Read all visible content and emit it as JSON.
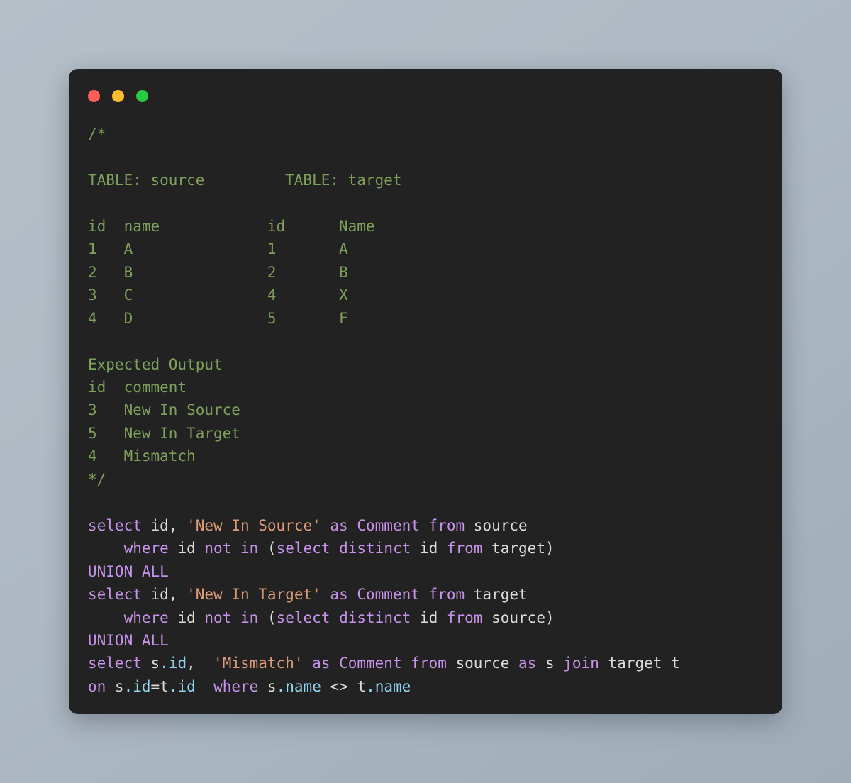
{
  "window": {
    "traffic_lights": [
      {
        "name": "close",
        "color": "#ff5f56"
      },
      {
        "name": "minimize",
        "color": "#ffbd2e"
      },
      {
        "name": "maximize",
        "color": "#27c93f"
      }
    ],
    "background_color": "#222222",
    "page_background_color": "#aeb9c3"
  },
  "theme": {
    "comment_color": "#7fa05a",
    "keyword_color": "#c792ea",
    "string_color": "#dd9a77",
    "identifier_color": "#dcdcdc",
    "property_color": "#8fd4f0"
  },
  "editor": {
    "language": "sql",
    "lines": [
      {
        "id": "l1",
        "tokens": [
          {
            "t": "/*",
            "c": "comment"
          }
        ]
      },
      {
        "id": "l2",
        "tokens": []
      },
      {
        "id": "l3",
        "tokens": [
          {
            "t": "TABLE: source         TABLE: target",
            "c": "comment"
          }
        ]
      },
      {
        "id": "l4",
        "tokens": []
      },
      {
        "id": "l5",
        "tokens": [
          {
            "t": "id  name            id      Name",
            "c": "comment"
          }
        ]
      },
      {
        "id": "l6",
        "tokens": [
          {
            "t": "1   A               1       A",
            "c": "comment"
          }
        ]
      },
      {
        "id": "l7",
        "tokens": [
          {
            "t": "2   B               2       B",
            "c": "comment"
          }
        ]
      },
      {
        "id": "l8",
        "tokens": [
          {
            "t": "3   C               4       X",
            "c": "comment"
          }
        ]
      },
      {
        "id": "l9",
        "tokens": [
          {
            "t": "4   D               5       F",
            "c": "comment"
          }
        ]
      },
      {
        "id": "l10",
        "tokens": []
      },
      {
        "id": "l11",
        "tokens": [
          {
            "t": "Expected Output",
            "c": "comment"
          }
        ]
      },
      {
        "id": "l12",
        "tokens": [
          {
            "t": "id  comment",
            "c": "comment"
          }
        ]
      },
      {
        "id": "l13",
        "tokens": [
          {
            "t": "3   New In Source",
            "c": "comment"
          }
        ]
      },
      {
        "id": "l14",
        "tokens": [
          {
            "t": "5   New In Target",
            "c": "comment"
          }
        ]
      },
      {
        "id": "l15",
        "tokens": [
          {
            "t": "4   Mismatch",
            "c": "comment"
          }
        ]
      },
      {
        "id": "l16",
        "tokens": [
          {
            "t": "*/",
            "c": "comment"
          }
        ]
      },
      {
        "id": "l17",
        "tokens": []
      },
      {
        "id": "l18",
        "tokens": [
          {
            "t": "select",
            "c": "keyword"
          },
          {
            "t": " ",
            "c": "punct"
          },
          {
            "t": "id",
            "c": "ident"
          },
          {
            "t": ", ",
            "c": "punct"
          },
          {
            "t": "'New In Source'",
            "c": "string"
          },
          {
            "t": " ",
            "c": "punct"
          },
          {
            "t": "as",
            "c": "keyword"
          },
          {
            "t": " ",
            "c": "punct"
          },
          {
            "t": "Comment",
            "c": "keyword"
          },
          {
            "t": " ",
            "c": "punct"
          },
          {
            "t": "from",
            "c": "keyword"
          },
          {
            "t": " ",
            "c": "punct"
          },
          {
            "t": "source",
            "c": "ident"
          }
        ]
      },
      {
        "id": "l19",
        "tokens": [
          {
            "t": "    ",
            "c": "punct"
          },
          {
            "t": "where",
            "c": "keyword"
          },
          {
            "t": " ",
            "c": "punct"
          },
          {
            "t": "id",
            "c": "ident"
          },
          {
            "t": " ",
            "c": "punct"
          },
          {
            "t": "not",
            "c": "keyword"
          },
          {
            "t": " ",
            "c": "punct"
          },
          {
            "t": "in",
            "c": "keyword"
          },
          {
            "t": " (",
            "c": "punct"
          },
          {
            "t": "select",
            "c": "keyword"
          },
          {
            "t": " ",
            "c": "punct"
          },
          {
            "t": "distinct",
            "c": "keyword"
          },
          {
            "t": " ",
            "c": "punct"
          },
          {
            "t": "id",
            "c": "ident"
          },
          {
            "t": " ",
            "c": "punct"
          },
          {
            "t": "from",
            "c": "keyword"
          },
          {
            "t": " ",
            "c": "punct"
          },
          {
            "t": "target",
            "c": "ident"
          },
          {
            "t": ")",
            "c": "punct"
          }
        ]
      },
      {
        "id": "l20",
        "tokens": [
          {
            "t": "UNION ALL",
            "c": "keyword"
          }
        ]
      },
      {
        "id": "l21",
        "tokens": [
          {
            "t": "select",
            "c": "keyword"
          },
          {
            "t": " ",
            "c": "punct"
          },
          {
            "t": "id",
            "c": "ident"
          },
          {
            "t": ", ",
            "c": "punct"
          },
          {
            "t": "'New In Target'",
            "c": "string"
          },
          {
            "t": " ",
            "c": "punct"
          },
          {
            "t": "as",
            "c": "keyword"
          },
          {
            "t": " ",
            "c": "punct"
          },
          {
            "t": "Comment",
            "c": "keyword"
          },
          {
            "t": " ",
            "c": "punct"
          },
          {
            "t": "from",
            "c": "keyword"
          },
          {
            "t": " ",
            "c": "punct"
          },
          {
            "t": "target",
            "c": "ident"
          }
        ]
      },
      {
        "id": "l22",
        "tokens": [
          {
            "t": "    ",
            "c": "punct"
          },
          {
            "t": "where",
            "c": "keyword"
          },
          {
            "t": " ",
            "c": "punct"
          },
          {
            "t": "id",
            "c": "ident"
          },
          {
            "t": " ",
            "c": "punct"
          },
          {
            "t": "not",
            "c": "keyword"
          },
          {
            "t": " ",
            "c": "punct"
          },
          {
            "t": "in",
            "c": "keyword"
          },
          {
            "t": " (",
            "c": "punct"
          },
          {
            "t": "select",
            "c": "keyword"
          },
          {
            "t": " ",
            "c": "punct"
          },
          {
            "t": "distinct",
            "c": "keyword"
          },
          {
            "t": " ",
            "c": "punct"
          },
          {
            "t": "id",
            "c": "ident"
          },
          {
            "t": " ",
            "c": "punct"
          },
          {
            "t": "from",
            "c": "keyword"
          },
          {
            "t": " ",
            "c": "punct"
          },
          {
            "t": "source",
            "c": "ident"
          },
          {
            "t": ")",
            "c": "punct"
          }
        ]
      },
      {
        "id": "l23",
        "tokens": [
          {
            "t": "UNION ALL",
            "c": "keyword"
          }
        ]
      },
      {
        "id": "l24",
        "tokens": [
          {
            "t": "select",
            "c": "keyword"
          },
          {
            "t": " ",
            "c": "punct"
          },
          {
            "t": "s",
            "c": "ident"
          },
          {
            "t": ".id",
            "c": "prop"
          },
          {
            "t": ",  ",
            "c": "punct"
          },
          {
            "t": "'Mismatch'",
            "c": "string"
          },
          {
            "t": " ",
            "c": "punct"
          },
          {
            "t": "as",
            "c": "keyword"
          },
          {
            "t": " ",
            "c": "punct"
          },
          {
            "t": "Comment",
            "c": "keyword"
          },
          {
            "t": " ",
            "c": "punct"
          },
          {
            "t": "from",
            "c": "keyword"
          },
          {
            "t": " ",
            "c": "punct"
          },
          {
            "t": "source",
            "c": "ident"
          },
          {
            "t": " ",
            "c": "punct"
          },
          {
            "t": "as",
            "c": "keyword"
          },
          {
            "t": " ",
            "c": "punct"
          },
          {
            "t": "s",
            "c": "ident"
          },
          {
            "t": " ",
            "c": "punct"
          },
          {
            "t": "join",
            "c": "keyword"
          },
          {
            "t": " ",
            "c": "punct"
          },
          {
            "t": "target t",
            "c": "ident"
          }
        ]
      },
      {
        "id": "l25",
        "tokens": [
          {
            "t": "on",
            "c": "keyword"
          },
          {
            "t": " ",
            "c": "punct"
          },
          {
            "t": "s",
            "c": "ident"
          },
          {
            "t": ".id",
            "c": "prop"
          },
          {
            "t": "=",
            "c": "punct"
          },
          {
            "t": "t",
            "c": "ident"
          },
          {
            "t": ".id",
            "c": "prop"
          },
          {
            "t": "  ",
            "c": "punct"
          },
          {
            "t": "where",
            "c": "keyword"
          },
          {
            "t": " ",
            "c": "punct"
          },
          {
            "t": "s",
            "c": "ident"
          },
          {
            "t": ".name",
            "c": "prop"
          },
          {
            "t": " ",
            "c": "punct"
          },
          {
            "t": "<>",
            "c": "punct"
          },
          {
            "t": " ",
            "c": "punct"
          },
          {
            "t": "t",
            "c": "ident"
          },
          {
            "t": ".name",
            "c": "prop"
          }
        ]
      }
    ]
  }
}
